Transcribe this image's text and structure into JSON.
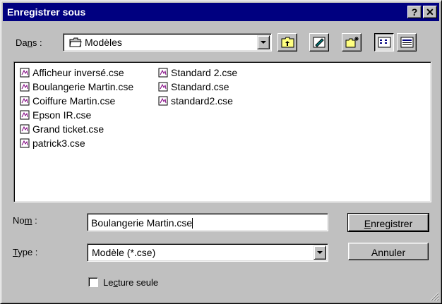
{
  "window": {
    "title": "Enregistrer sous",
    "help_btn": "?",
    "close_btn": "✕"
  },
  "lookin": {
    "label_pre": "Da",
    "label_u": "n",
    "label_post": "s :",
    "value": "Modèles"
  },
  "files": {
    "col1": [
      "Afficheur inversé.cse",
      "Boulangerie Martin.cse",
      "Coiffure Martin.cse",
      "Epson IR.cse",
      "Grand ticket.cse",
      "patrick3.cse"
    ],
    "col2": [
      "Standard 2.cse",
      "Standard.cse",
      "standard2.cse"
    ]
  },
  "name_field": {
    "label_pre": "No",
    "label_u": "m",
    "label_post": " :",
    "value": "Boulangerie Martin.cse"
  },
  "type_field": {
    "label_u": "T",
    "label_post": "ype :",
    "value": "Modèle (*.cse)"
  },
  "buttons": {
    "save_u": "E",
    "save_rest": "nregistrer",
    "cancel": "Annuler"
  },
  "readonly": {
    "label_pre": "Le",
    "label_u": "c",
    "label_post": "ture seule",
    "checked": false
  }
}
